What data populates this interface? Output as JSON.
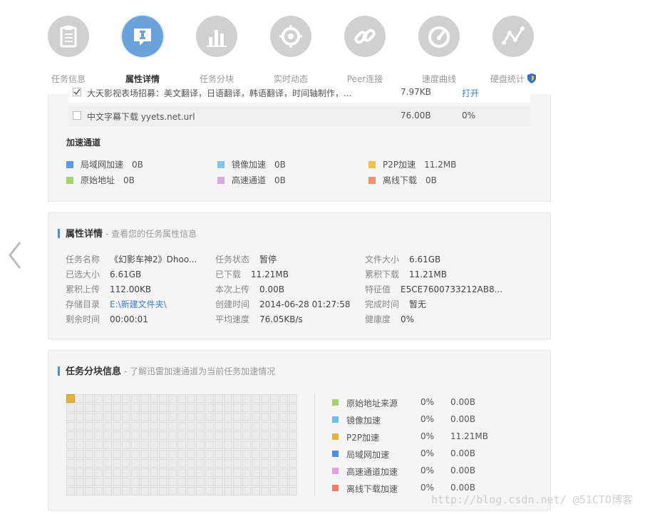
{
  "nav": {
    "tabs": [
      {
        "label": "任务信息",
        "icon": "clipboard-icon"
      },
      {
        "label": "属性详情",
        "icon": "chat-info-icon"
      },
      {
        "label": "任务分块",
        "icon": "bar-chart-icon"
      },
      {
        "label": "实时动态",
        "icon": "crosshair-icon"
      },
      {
        "label": "Peer连接",
        "icon": "link-icon"
      },
      {
        "label": "速度曲线",
        "icon": "gauge-icon"
      },
      {
        "label": "硬盘统计",
        "icon": "line-graph-icon"
      }
    ],
    "active_tab": 1
  },
  "files": {
    "rows": [
      {
        "name": "大天影视表场招募：美文翻译，日语翻译，韩语翻译，时间轴制作，...",
        "size": "7.97KB",
        "action": "打开",
        "checked": true
      },
      {
        "name": "中文字幕下载 yyets.net.url",
        "size": "76.00B",
        "pct": "0%",
        "checked": false
      }
    ]
  },
  "accel": {
    "title": "加速通道",
    "items": [
      {
        "name": "局域网加速",
        "value": "0B",
        "color": "#5b9be8"
      },
      {
        "name": "镜像加速",
        "value": "0B",
        "color": "#7ec7ee"
      },
      {
        "name": "P2P加速",
        "value": "11.2MB",
        "color": "#f5c04a"
      },
      {
        "name": "原始地址",
        "value": "0B",
        "color": "#a6d36a"
      },
      {
        "name": "高速通道",
        "value": "0B",
        "color": "#d8a9e3"
      },
      {
        "name": "离线下载",
        "value": "0B",
        "color": "#f0916f"
      }
    ]
  },
  "props": {
    "title": "属性详情",
    "subtitle": "- 查看您的任务属性信息",
    "fields": [
      {
        "label": "任务名称",
        "value": "《幻影车神2》Dhoo..."
      },
      {
        "label": "任务状态",
        "value": "暂停"
      },
      {
        "label": "文件大小",
        "value": "6.61GB"
      },
      {
        "label": "已选大小",
        "value": "6.61GB"
      },
      {
        "label": "已下载",
        "value": "11.21MB"
      },
      {
        "label": "累积下载",
        "value": "11.21MB"
      },
      {
        "label": "累积上传",
        "value": "112.00KB"
      },
      {
        "label": "本次上传",
        "value": "0.00B"
      },
      {
        "label": "特征值",
        "value": "E5CE7600733212AB8..."
      },
      {
        "label": "存储目录",
        "value": "E:\\新建文件夹\\"
      },
      {
        "label": "创建时间",
        "value": "2014-06-28 01:27:58"
      },
      {
        "label": "完成时间",
        "value": "暂无"
      },
      {
        "label": "剩余时间",
        "value": "00:00:01"
      },
      {
        "label": "平均速度",
        "value": "76.05KB/s"
      },
      {
        "label": "健康度",
        "value": "0%"
      }
    ]
  },
  "blocks": {
    "title": "任务分块信息",
    "subtitle": "- 了解迅雷加速通道为当前任务加速情况",
    "stats": [
      {
        "name": "原始地址来源",
        "pct": "0%",
        "value": "0.00B",
        "color": "#a6d36a"
      },
      {
        "name": "镜像加速",
        "pct": "0%",
        "value": "0.00B",
        "color": "#6fbde8"
      },
      {
        "name": "P2P加速",
        "pct": "0%",
        "value": "11.21MB",
        "color": "#e8b23a"
      },
      {
        "name": "局域网加速",
        "pct": "0%",
        "value": "0.00B",
        "color": "#4d8fdc"
      },
      {
        "name": "高速通道加速",
        "pct": "0%",
        "value": "0.00B",
        "color": "#e3a0dc"
      },
      {
        "name": "离线下载加速",
        "pct": "0%",
        "value": "0.00B",
        "color": "#ef7f62"
      }
    ]
  },
  "watermark": "http://blog.csdn.net/  @51CTO博客"
}
